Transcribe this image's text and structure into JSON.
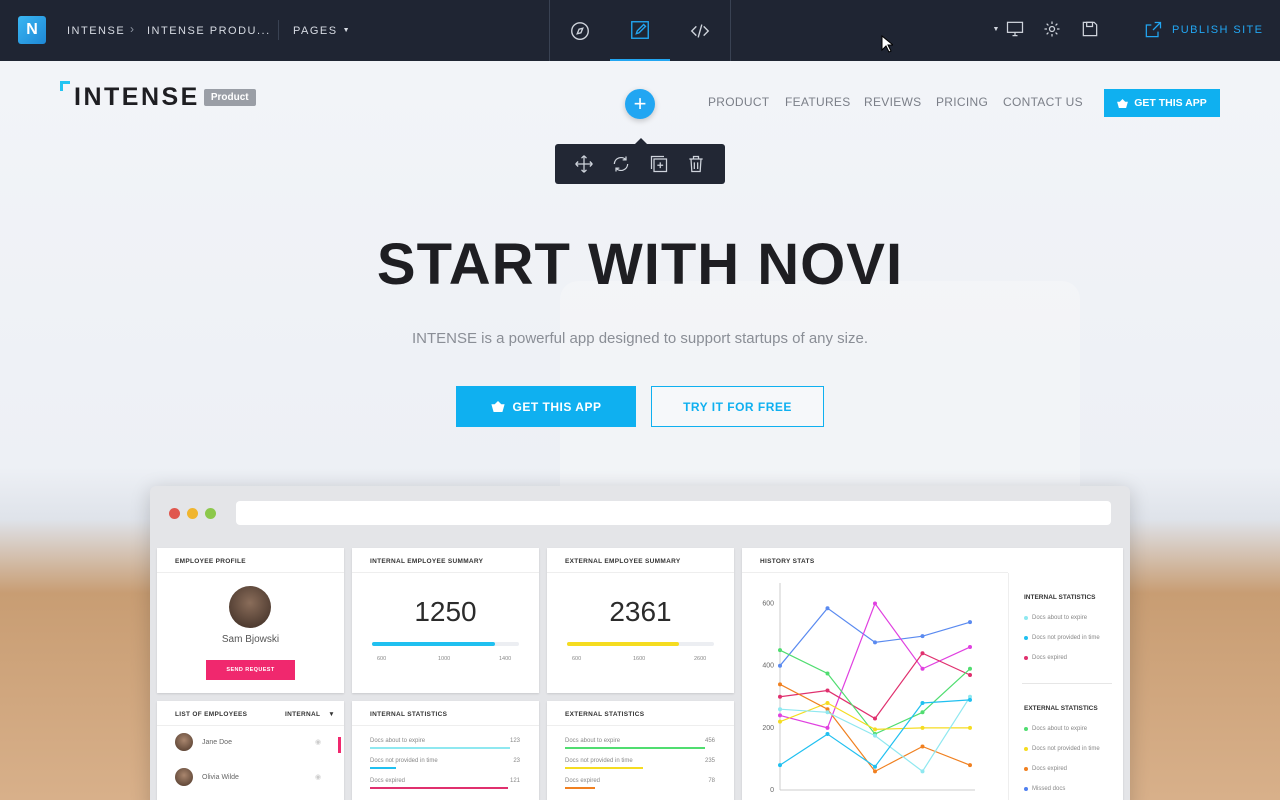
{
  "topbar": {
    "crumb_root": "INTENSE",
    "crumb_sep": "›",
    "crumb_page": "INTENSE PRODU...",
    "pages_label": "PAGES",
    "publish_label": "PUBLISH SITE",
    "accent": "#22a6f2",
    "icons": [
      "compass-icon",
      "pencil-icon",
      "code-icon",
      "monitor-icon",
      "gear-icon",
      "save-icon",
      "external-link-icon"
    ]
  },
  "site": {
    "logo_word": "INTENSE",
    "logo_badge": "Product",
    "nav": [
      "PRODUCT",
      "FEATURES",
      "REVIEWS",
      "PRICING",
      "CONTACT US"
    ],
    "get_app_top": "GET THIS APP",
    "hero_title": "START WITH NOVI",
    "hero_subtitle": "INTENSE is a powerful app designed to support startups of any size.",
    "btn_primary": "GET THIS APP",
    "btn_secondary": "TRY IT FOR FREE",
    "accent": "#0fb0f0"
  },
  "element_toolbar": {
    "icons": [
      "move-icon",
      "refresh-icon",
      "duplicate-icon",
      "trash-icon"
    ]
  },
  "dashboard": {
    "profile": {
      "title": "EMPLOYEE PROFILE",
      "name": "Sam Bjowski",
      "button": "SEND REQUEST"
    },
    "internal_summary": {
      "title": "INTERNAL EMPLOYEE SUMMARY",
      "value": "1250",
      "scale": [
        "600",
        "1000",
        "1400"
      ],
      "fill": 0.84,
      "color": "#20c0f0"
    },
    "external_summary": {
      "title": "EXTERNAL EMPLOYEE SUMMARY",
      "value": "2361",
      "scale": [
        "600",
        "1600",
        "2600"
      ],
      "fill": 0.76,
      "color": "#f5dc20"
    },
    "list": {
      "title": "LIST OF EMPLOYEES",
      "filter": "INTERNAL",
      "rows": [
        "Jane Doe",
        "Olivia Wilde"
      ]
    },
    "internal_stats": {
      "title": "INTERNAL STATISTICS",
      "rows": [
        {
          "label": "Docs about to expire",
          "value": "123",
          "color": "#8fe8f0"
        },
        {
          "label": "Docs not provided in time",
          "value": "23",
          "color": "#20c0f0"
        },
        {
          "label": "Docs expired",
          "value": "121",
          "color": "#e0306e"
        }
      ]
    },
    "external_stats": {
      "title": "EXTERNAL STATISTICS",
      "rows": [
        {
          "label": "Docs about to expire",
          "value": "456",
          "color": "#50dd70"
        },
        {
          "label": "Docs not provided in time",
          "value": "235",
          "color": "#f5dc20"
        },
        {
          "label": "Docs expired",
          "value": "78",
          "color": "#f08020"
        }
      ]
    },
    "history": {
      "title": "HISTORY STATS",
      "yticks": [
        "600",
        "400",
        "200",
        "0"
      ],
      "internal_title": "INTERNAL STATISTICS",
      "internal_legend": [
        {
          "label": "Docs about to expire",
          "color": "#8fe8f0"
        },
        {
          "label": "Docs not provided in time",
          "color": "#20c0f0"
        },
        {
          "label": "Docs expired",
          "color": "#e0306e"
        }
      ],
      "external_title": "EXTERNAL STATISTICS",
      "external_legend": [
        {
          "label": "Docs about to expire",
          "color": "#50dd70"
        },
        {
          "label": "Docs not provided in time",
          "color": "#f5dc20"
        },
        {
          "label": "Docs expired",
          "color": "#f08020"
        },
        {
          "label": "Missed docs",
          "color": "#5080f0"
        }
      ]
    }
  },
  "chart_data": {
    "type": "line",
    "title": "HISTORY STATS",
    "ylim": [
      0,
      650
    ],
    "x": [
      1,
      2,
      3,
      4,
      5
    ],
    "series": [
      {
        "color": "#5a8af0",
        "values": [
          400,
          585,
          475,
          495,
          540
        ]
      },
      {
        "color": "#e040e0",
        "values": [
          240,
          200,
          600,
          390,
          460
        ]
      },
      {
        "color": "#e0306e",
        "values": [
          300,
          320,
          230,
          440,
          370
        ]
      },
      {
        "color": "#50dd70",
        "values": [
          450,
          375,
          180,
          250,
          390
        ]
      },
      {
        "color": "#f5dc20",
        "values": [
          220,
          280,
          195,
          200,
          200
        ]
      },
      {
        "color": "#f08020",
        "values": [
          340,
          260,
          60,
          140,
          80
        ]
      },
      {
        "color": "#8fe8f0",
        "values": [
          260,
          250,
          175,
          60,
          300
        ]
      },
      {
        "color": "#20c0f0",
        "values": [
          80,
          180,
          75,
          280,
          290
        ]
      }
    ]
  }
}
